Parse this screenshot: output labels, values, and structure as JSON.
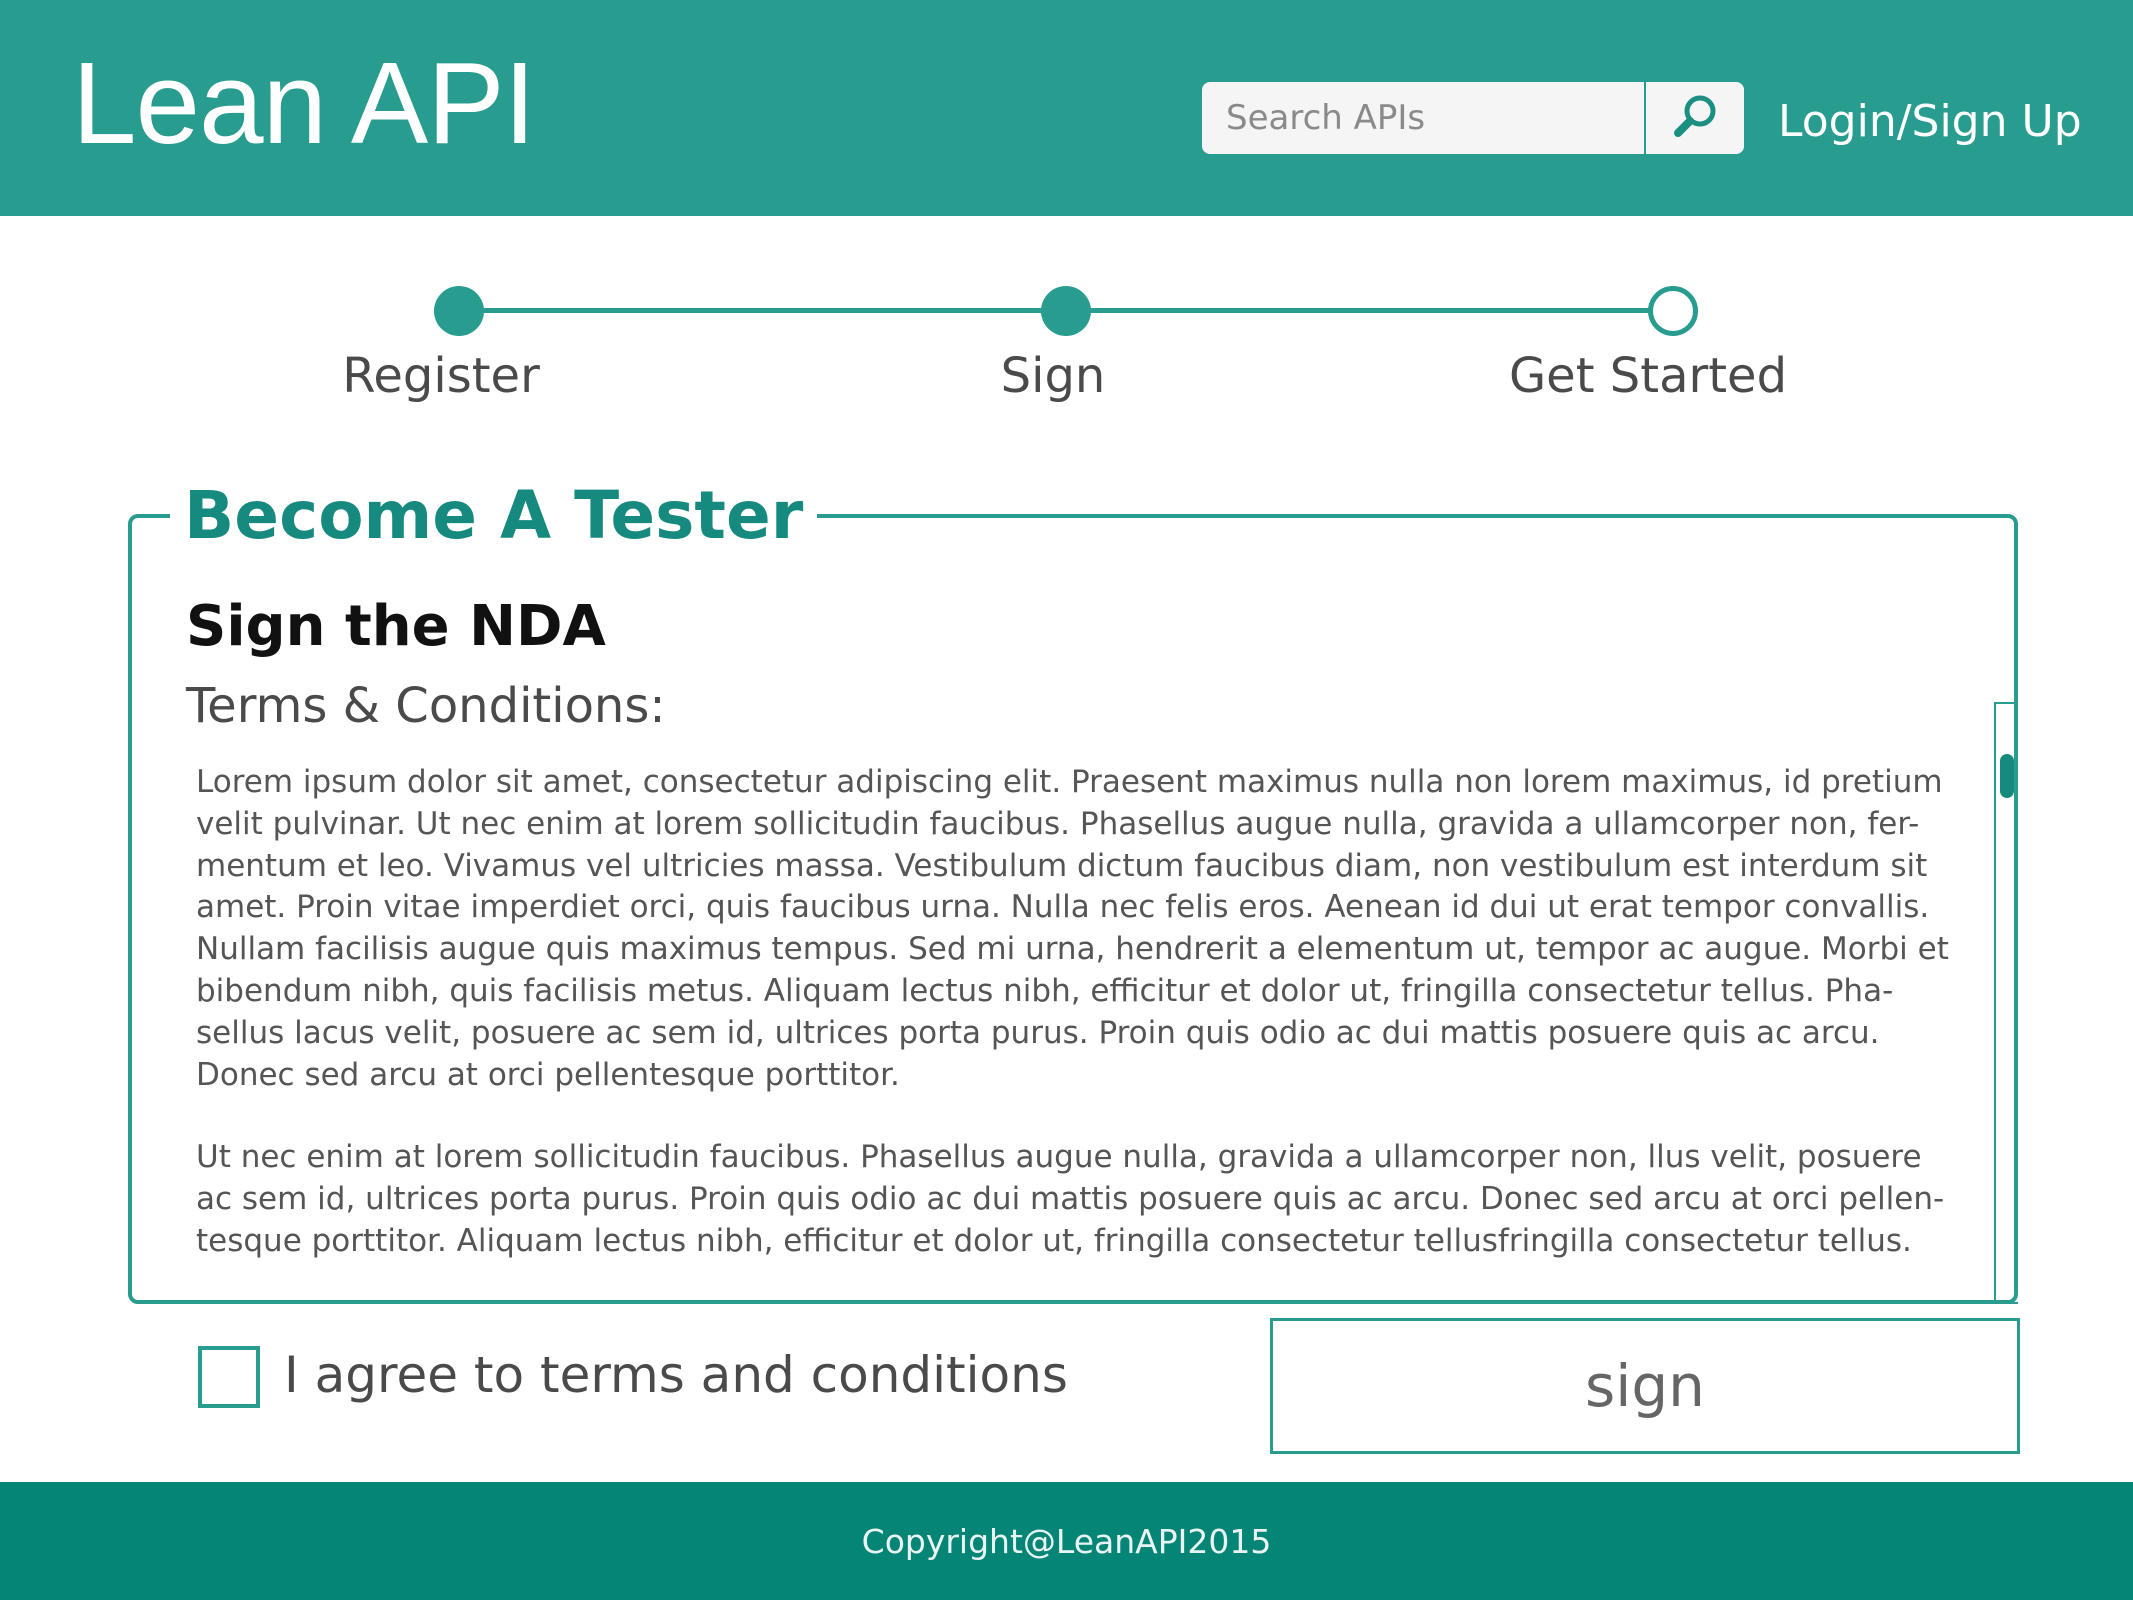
{
  "header": {
    "logo": "Lean API",
    "search": {
      "placeholder": "Search APIs",
      "value": "",
      "icon": "search-icon"
    },
    "login": "Login/Sign Up"
  },
  "stepper": {
    "steps": [
      {
        "label": "Register",
        "state": "complete"
      },
      {
        "label": "Sign",
        "state": "complete"
      },
      {
        "label": "Get Started",
        "state": "pending"
      }
    ]
  },
  "panel": {
    "legend": "Become A Tester",
    "title": "Sign the NDA",
    "terms_heading": "Terms & Conditions:",
    "paragraphs": [
      "Lorem ipsum dolor sit amet, consectetur adipiscing elit. Praesent maximus nulla non lorem maximus, id pretium velit pulvinar. Ut nec enim at lorem sollicitudin faucibus. Phasellus augue nulla, gravida a ullamcorper non, fer-mentum et leo. Vivamus vel ultricies massa. Vestibulum dictum faucibus diam, non vestibulum est interdum sit amet. Proin vitae imperdiet orci, quis faucibus urna. Nulla nec felis eros. Aenean id dui ut erat tempor convallis. Nullam facilisis augue quis maximus tempus. Sed mi urna, hendrerit a elementum ut, tempor ac augue. Morbi et bibendum nibh, quis facilisis metus. Aliquam lectus nibh, efficitur et dolor ut, fringilla consectetur tellus. Pha-sellus lacus velit, posuere ac sem id, ultrices porta purus. Proin quis odio ac dui mattis posuere quis ac arcu. Donec sed arcu at orci pellentesque porttitor.",
      "Ut nec enim at lorem sollicitudin faucibus. Phasellus augue nulla, gravida a ullamcorper non, llus velit, posuere ac sem id, ultrices porta purus. Proin quis odio ac dui mattis posuere quis ac arcu. Donec sed arcu at orci pellen-tesque porttitor.  Aliquam lectus nibh, efficitur et dolor ut, fringilla consectetur tellusfringilla consectetur tellus."
    ]
  },
  "agreement": {
    "label": "I agree to terms and conditions",
    "checked": false
  },
  "sign_button": "sign",
  "footer": {
    "copyright": "Copyright@LeanAPI2015"
  },
  "colors": {
    "brand": "#279c8f",
    "brand_dark": "#058576",
    "heading_accent": "#168a7e"
  }
}
